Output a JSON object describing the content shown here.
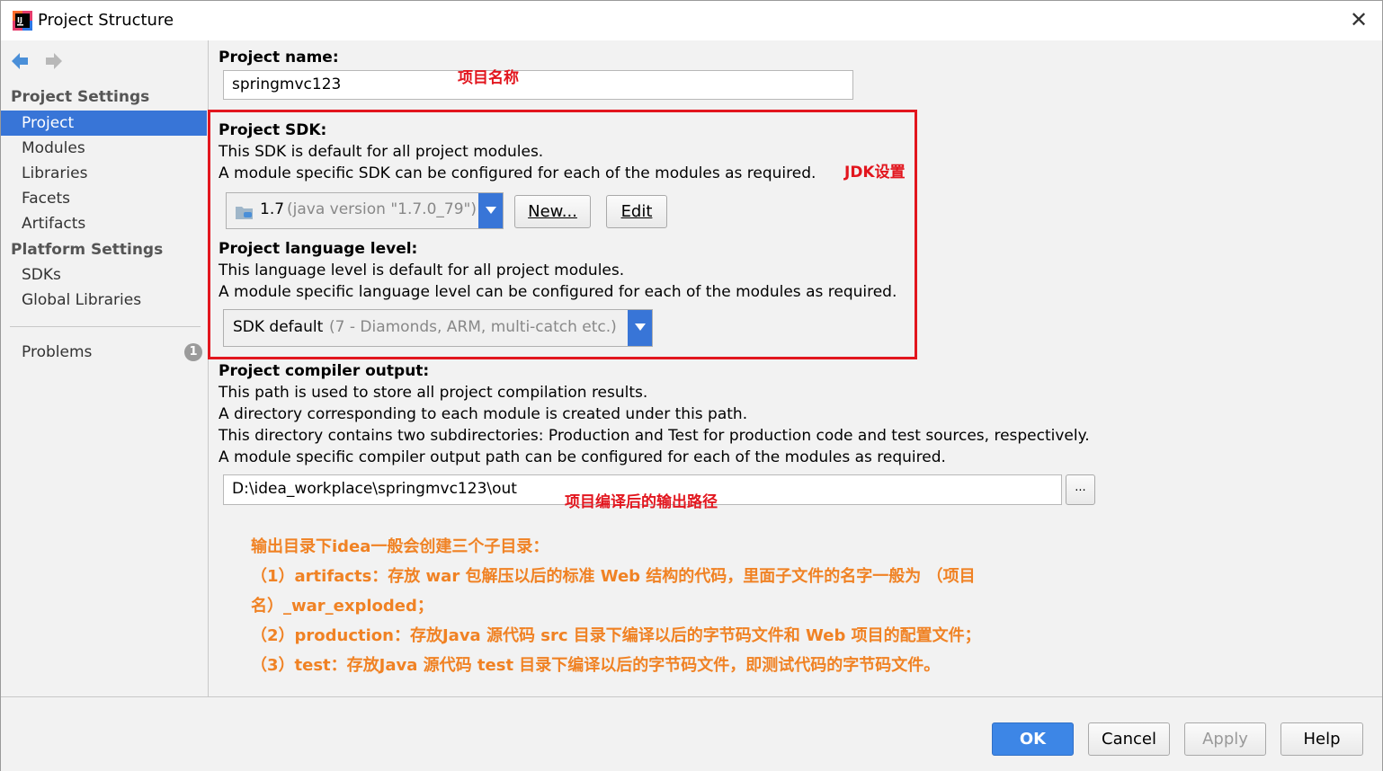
{
  "window": {
    "title": "Project Structure"
  },
  "sidebar": {
    "project_settings_header": "Project Settings",
    "project_items": [
      "Project",
      "Modules",
      "Libraries",
      "Facets",
      "Artifacts"
    ],
    "platform_settings_header": "Platform Settings",
    "platform_items": [
      "SDKs",
      "Global Libraries"
    ],
    "problems_label": "Problems",
    "problems_count": "1"
  },
  "main": {
    "project_name_label": "Project name:",
    "project_name_value": "springmvc123",
    "sdk_label": "Project SDK:",
    "sdk_desc1": "This SDK is default for all project modules.",
    "sdk_desc2": "A module specific SDK can be configured for each of the modules as required.",
    "sdk_combo_main": "1.7",
    "sdk_combo_detail": "(java version \"1.7.0_79\")",
    "new_button": "New...",
    "edit_button": "Edit",
    "lang_label": "Project language level:",
    "lang_desc1": "This language level is default for all project modules.",
    "lang_desc2": "A module specific language level can be configured for each of the modules as required.",
    "lang_combo_main": "SDK default",
    "lang_combo_detail": "(7 - Diamonds, ARM, multi-catch etc.)",
    "output_label": "Project compiler output:",
    "output_desc1": "This path is used to store all project compilation results.",
    "output_desc2": "A directory corresponding to each module is created under this path.",
    "output_desc3": "This directory contains two subdirectories: Production and Test for production code and test sources, respectively.",
    "output_desc4": "A module specific compiler output path can be configured for each of the modules as required.",
    "output_path": "D:\\idea_workplace\\springmvc123\\out",
    "browse_button": "..."
  },
  "annotations": {
    "project_name_note": "项目名称",
    "jdk_note": "JDK设置",
    "output_note": "项目编译后的输出路径",
    "lines": [
      "输出目录下idea一般会创建三个子目录：",
      "（1）artifacts：存放 war 包解压以后的标准 Web 结构的代码，里面子文件的名字一般为 （项目",
      "名）_war_exploded；",
      "（2）production：存放Java 源代码 src 目录下编译以后的字节码文件和 Web 项目的配置文件；",
      "（3）test：存放Java 源代码 test 目录下编译以后的字节码文件，即测试代码的字节码文件。"
    ]
  },
  "footer": {
    "ok": "OK",
    "cancel": "Cancel",
    "apply": "Apply",
    "help": "Help"
  },
  "colors": {
    "selection": "#3875d7",
    "annotation_red": "#e2161e",
    "annotation_orange": "#f08224",
    "primary_button": "#3d86e6"
  }
}
